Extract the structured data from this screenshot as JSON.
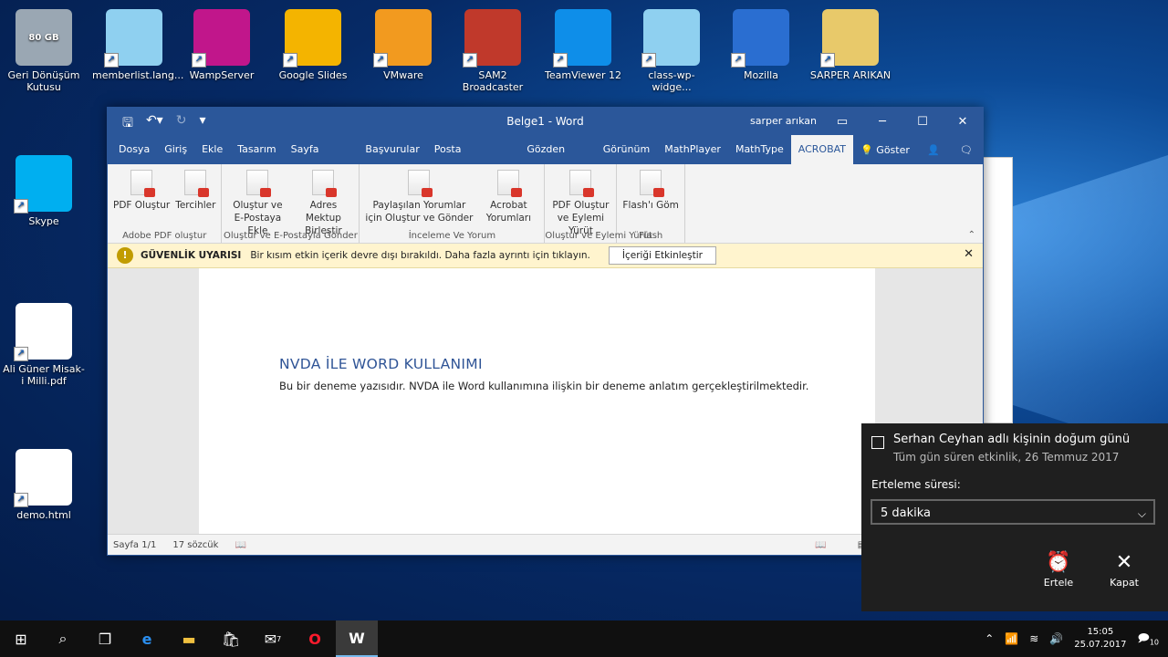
{
  "desktop": {
    "icons": [
      {
        "label": "Geri Dönüşüm Kutusu",
        "badge": "80 GB",
        "icon": "recycle-bin-icon",
        "color": "#9aa7b3"
      },
      {
        "label": "memberlist.lang...",
        "icon": "notepad-icon",
        "color": "#8fd0f0"
      },
      {
        "label": "WampServer",
        "icon": "wampserver-icon",
        "color": "#c1168b"
      },
      {
        "label": "Google Slides",
        "icon": "google-slides-icon",
        "color": "#f4b400"
      },
      {
        "label": "VMware",
        "icon": "vmware-icon",
        "color": "#f29a1f"
      },
      {
        "label": "SAM2 Broadcaster",
        "icon": "sam-broadcaster-icon",
        "color": "#c0392b"
      },
      {
        "label": "TeamViewer 12",
        "icon": "teamviewer-icon",
        "color": "#0e8ee9"
      },
      {
        "label": "class-wp-widge...",
        "icon": "notepad-icon",
        "color": "#8fd0f0"
      },
      {
        "label": "Mozilla",
        "icon": "thunderbird-icon",
        "color": "#2a6ed1"
      },
      {
        "label": "SARPER ARIKAN",
        "icon": "folder-icon",
        "color": "#e8c96a"
      },
      {
        "label": "Skype",
        "icon": "skype-icon",
        "color": "#00aff0"
      },
      {
        "label": "Ali Güner Misak-i Milli.pdf",
        "icon": "edge-pdf-icon",
        "color": "#ffffff"
      },
      {
        "label": "demo.html",
        "icon": "firefox-file-icon",
        "color": "#ffffff"
      }
    ]
  },
  "word": {
    "title": "Belge1 - Word",
    "user": "sarper arıkan",
    "tabs": [
      "Dosya",
      "Giriş",
      "Ekle",
      "Tasarım",
      "Sayfa Düzeni",
      "Başvurular",
      "Posta Gönderileri",
      "Gözden Geçir",
      "Görünüm",
      "MathPlayer",
      "MathType",
      "ACROBAT"
    ],
    "active_tab": "ACROBAT",
    "tell_me": "Göster",
    "ribbon_groups": [
      {
        "label": "Adobe PDF oluştur",
        "buttons": [
          "PDF Oluştur",
          "Tercihler"
        ]
      },
      {
        "label": "Oluştur ve E-Postayla Gönder",
        "buttons": [
          "Oluştur ve E-Postaya Ekle",
          "Adres Mektup Birleştir"
        ]
      },
      {
        "label": "İnceleme Ve Yorum",
        "buttons": [
          "Paylaşılan Yorumlar için Oluştur ve Gönder",
          "Acrobat Yorumları"
        ]
      },
      {
        "label": "Oluştur ve Eylemi Yürüt",
        "buttons": [
          "PDF Oluştur ve Eylemi Yürüt"
        ]
      },
      {
        "label": "Flash",
        "buttons": [
          "Flash'ı Göm"
        ]
      }
    ],
    "security": {
      "title": "GÜVENLİK UYARISI",
      "message": "Bir kısım etkin içerik devre dışı bırakıldı. Daha fazla ayrıntı için tıklayın.",
      "button": "İçeriği Etkinleştir"
    },
    "document": {
      "heading": "NVDA İLE WORD KULLANIMI",
      "paragraph": "Bu bir deneme yazısıdır. NVDA ile Word kullanımına ilişkin bir deneme anlatım gerçekleştirilmektedir."
    },
    "status": {
      "page": "Sayfa 1/1",
      "words": "17 sözcük"
    }
  },
  "notification": {
    "title": "Serhan Ceyhan adlı kişinin doğum günü",
    "subtitle": "Tüm gün süren etkinlik, 26 Temmuz 2017",
    "snooze_label": "Erteleme süresi:",
    "snooze_value": "5 dakika",
    "snooze_button": "Ertele",
    "close_button": "Kapat"
  },
  "taskbar": {
    "time": "15:05",
    "date": "25.07.2017",
    "notification_count": "10",
    "mail_badge": "7"
  }
}
